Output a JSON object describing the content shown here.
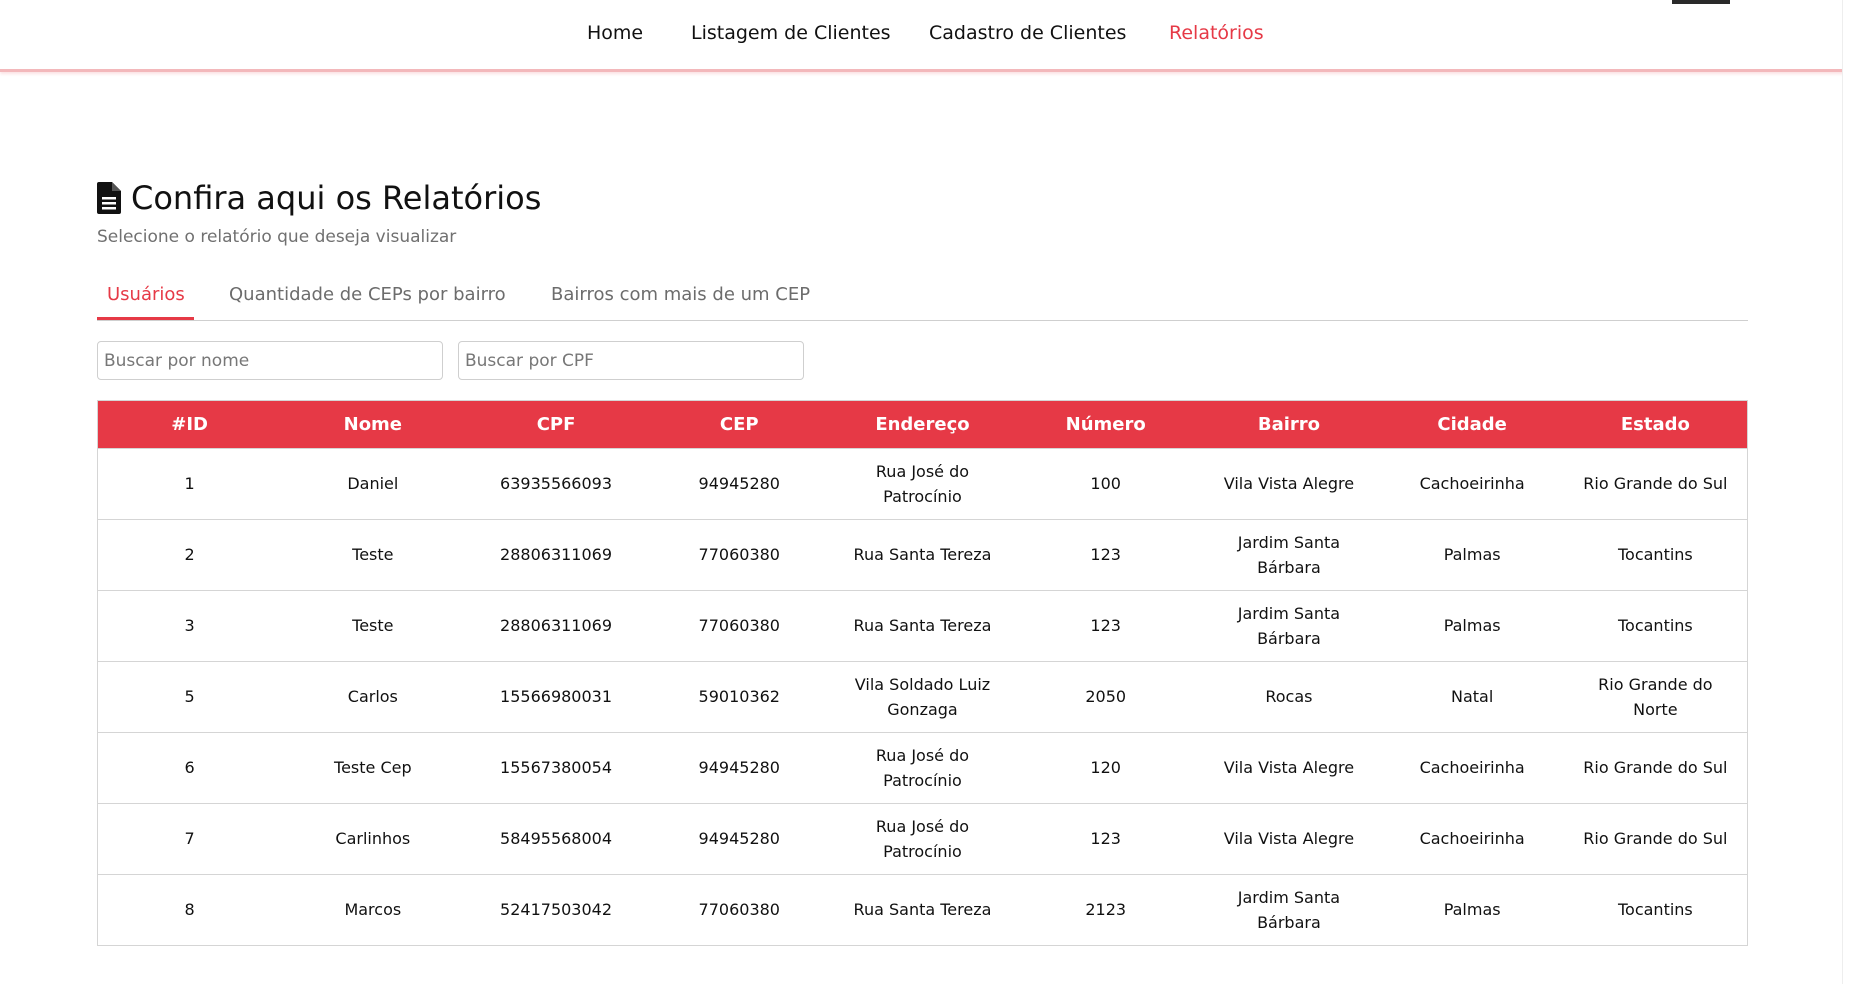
{
  "nav": {
    "items": [
      {
        "label": "Home"
      },
      {
        "label": "Listagem de Clientes"
      },
      {
        "label": "Cadastro de Clientes"
      },
      {
        "label": "Relatórios"
      }
    ],
    "active": "Relatórios"
  },
  "header": {
    "icon": "file-document-icon",
    "title": "Confira aqui os Relatórios",
    "subtitle": "Selecione o relatório que deseja visualizar"
  },
  "tabs": [
    {
      "label": "Usuários",
      "active": true
    },
    {
      "label": "Quantidade de CEPs por bairro",
      "active": false
    },
    {
      "label": "Bairros com mais de um CEP",
      "active": false
    }
  ],
  "search": {
    "name_placeholder": "Buscar por nome",
    "cpf_placeholder": "Buscar por CPF"
  },
  "table": {
    "columns": [
      "#ID",
      "Nome",
      "CPF",
      "CEP",
      "Endereço",
      "Número",
      "Bairro",
      "Cidade",
      "Estado"
    ],
    "rows": [
      [
        "1",
        "Daniel",
        "63935566093",
        "94945280",
        "Rua José do Patrocínio",
        "100",
        "Vila Vista Alegre",
        "Cachoeirinha",
        "Rio Grande do Sul"
      ],
      [
        "2",
        "Teste",
        "28806311069",
        "77060380",
        "Rua Santa Tereza",
        "123",
        "Jardim Santa Bárbara",
        "Palmas",
        "Tocantins"
      ],
      [
        "3",
        "Teste",
        "28806311069",
        "77060380",
        "Rua Santa Tereza",
        "123",
        "Jardim Santa Bárbara",
        "Palmas",
        "Tocantins"
      ],
      [
        "5",
        "Carlos",
        "15566980031",
        "59010362",
        "Vila Soldado Luiz Gonzaga",
        "2050",
        "Rocas",
        "Natal",
        "Rio Grande do Norte"
      ],
      [
        "6",
        "Teste Cep",
        "15567380054",
        "94945280",
        "Rua José do Patrocínio",
        "120",
        "Vila Vista Alegre",
        "Cachoeirinha",
        "Rio Grande do Sul"
      ],
      [
        "7",
        "Carlinhos",
        "58495568004",
        "94945280",
        "Rua José do Patrocínio",
        "123",
        "Vila Vista Alegre",
        "Cachoeirinha",
        "Rio Grande do Sul"
      ],
      [
        "8",
        "Marcos",
        "52417503042",
        "77060380",
        "Rua Santa Tereza",
        "2123",
        "Jardim Santa Bárbara",
        "Palmas",
        "Tocantins"
      ]
    ]
  },
  "colors": {
    "accent": "#e63946",
    "text": "#111111",
    "muted": "#707070"
  }
}
